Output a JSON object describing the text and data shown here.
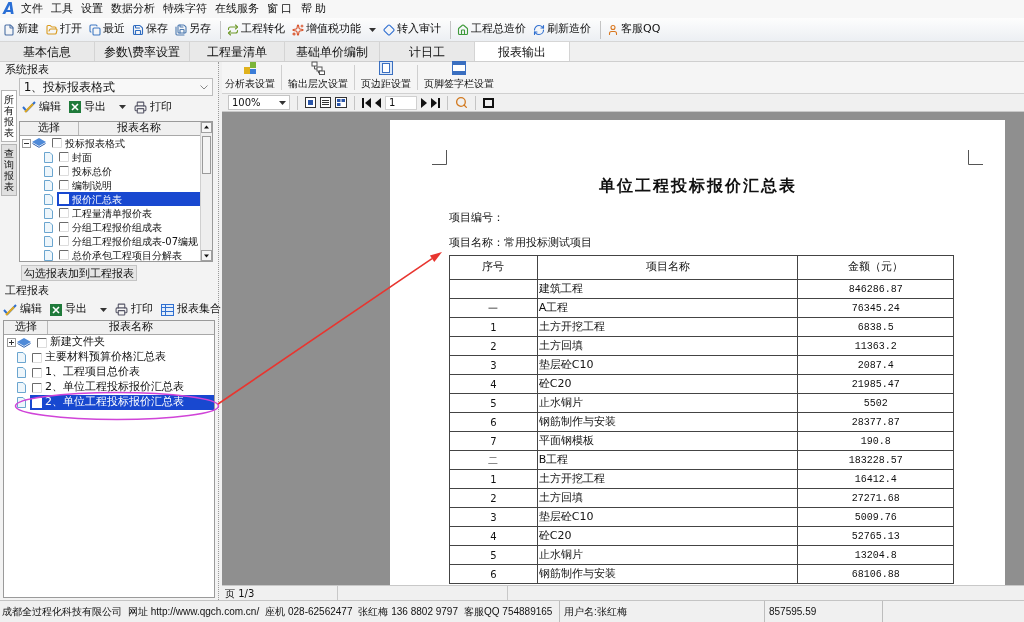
{
  "app_logo": "A",
  "menu": [
    "文件",
    "工具",
    "设置",
    "数据分析",
    "特殊字符",
    "在线服务",
    "窗 口",
    "帮 助"
  ],
  "toolbar": [
    {
      "items": [
        {
          "label": "新建",
          "has_menu": false
        },
        {
          "label": "打开",
          "has_menu": false
        },
        {
          "label": "最近",
          "has_menu": false
        },
        {
          "label": "保存",
          "has_menu": false
        },
        {
          "label": "另存",
          "has_menu": false
        }
      ]
    },
    {
      "items": [
        {
          "label": "工程转化",
          "has_menu": false
        },
        {
          "label": "增值税功能",
          "has_menu": true
        },
        {
          "label": "转入审计",
          "has_menu": false
        }
      ]
    },
    {
      "items": [
        {
          "label": "工程总造价",
          "has_menu": false
        },
        {
          "label": "刷新造价",
          "has_menu": false
        }
      ]
    },
    {
      "items": [
        {
          "label": "客服QQ",
          "has_menu": false
        }
      ]
    }
  ],
  "tabs": [
    {
      "label": "基本信息",
      "selected": false
    },
    {
      "label": "参数\\费率设置",
      "selected": false
    },
    {
      "label": "工程量清单",
      "selected": false
    },
    {
      "label": "基础单价编制",
      "selected": false
    },
    {
      "label": "计日工",
      "selected": false
    },
    {
      "label": "报表输出",
      "selected": true
    }
  ],
  "system_reports": {
    "title": "系统报表",
    "side_tabs": [
      {
        "label": "所有报表",
        "selected": true
      },
      {
        "label": "查询报表",
        "selected": false
      }
    ],
    "format_select": {
      "value": "1、投标报表格式"
    },
    "toolbar": [
      {
        "label": "编辑",
        "has_menu": false
      },
      {
        "label": "导出",
        "has_menu": true
      },
      {
        "label": "打印",
        "has_menu": false
      }
    ],
    "columns": [
      "选择",
      "报表名称"
    ],
    "tree": [
      {
        "kind": "folder",
        "label": "投标报表格式",
        "expanded": true,
        "checked": false,
        "selected": false,
        "children": [
          {
            "kind": "report",
            "label": "封面",
            "checked": false,
            "selected": false
          },
          {
            "kind": "report",
            "label": "投标总价",
            "checked": false,
            "selected": false
          },
          {
            "kind": "report",
            "label": "编制说明",
            "checked": false,
            "selected": false
          },
          {
            "kind": "report",
            "label": "报价汇总表",
            "checked": false,
            "selected": true
          },
          {
            "kind": "report",
            "label": "工程量清单报价表",
            "checked": false,
            "selected": false
          },
          {
            "kind": "report",
            "label": "分组工程报价组成表",
            "checked": false,
            "selected": false
          },
          {
            "kind": "report",
            "label": "分组工程报价组成表-07编规",
            "checked": false,
            "selected": false
          },
          {
            "kind": "report",
            "label": "总价承包工程项目分解表",
            "checked": false,
            "selected": false
          }
        ]
      }
    ],
    "add_button": "勾选报表加到工程报表"
  },
  "project_reports": {
    "title": "工程报表",
    "toolbar": [
      {
        "label": "编辑",
        "has_menu": false
      },
      {
        "label": "导出",
        "has_menu": true
      },
      {
        "label": "打印",
        "has_menu": false
      },
      {
        "label": "报表集合",
        "has_menu": false
      }
    ],
    "columns": [
      "选择",
      "报表名称"
    ],
    "tree": [
      {
        "kind": "folder",
        "label": "新建文件夹",
        "expanded": false,
        "checked": false,
        "selected": false
      },
      {
        "kind": "report",
        "label": "主要材料预算价格汇总表",
        "checked": false,
        "selected": false
      },
      {
        "kind": "report",
        "label": "1、工程项目总价表",
        "checked": false,
        "selected": false
      },
      {
        "kind": "report",
        "label": "2、单位工程投标报价汇总表",
        "checked": false,
        "selected": false
      },
      {
        "kind": "report",
        "label": "2、单位工程投标报价汇总表",
        "checked": false,
        "selected": true
      }
    ]
  },
  "report_toolbar": [
    {
      "label": "分析表设置"
    },
    {
      "label": "输出层次设置"
    },
    {
      "label": "页边距设置"
    },
    {
      "label": "页脚签字栏设置"
    }
  ],
  "preview_toolbar": {
    "zoom": "100%",
    "page": "1"
  },
  "report_page": {
    "title": "单位工程投标报价汇总表",
    "info": [
      "项目编号：",
      "项目名称：常用投标测试项目"
    ],
    "columns": [
      "序号",
      "项目名称",
      "金额（元）"
    ],
    "rows": [
      {
        "name": "建筑工程",
        "amount": "846286.87"
      },
      {
        "no": "一",
        "name": "A工程",
        "amount": "76345.24"
      },
      {
        "no": "1",
        "name": "土方开挖工程",
        "amount": "6838.5"
      },
      {
        "no": "2",
        "name": "土方回填",
        "amount": "11363.2"
      },
      {
        "no": "3",
        "name": "垫层砼C10",
        "amount": "2087.4"
      },
      {
        "no": "4",
        "name": "砼C20",
        "amount": "21985.47"
      },
      {
        "no": "5",
        "name": "止水铜片",
        "amount": "5502"
      },
      {
        "no": "6",
        "name": "钢筋制作与安装",
        "amount": "28377.87"
      },
      {
        "no": "7",
        "name": "平面钢模板",
        "amount": "190.8"
      },
      {
        "no": "二",
        "name": "B工程",
        "amount": "183228.57"
      },
      {
        "no": "1",
        "name": "土方开挖工程",
        "amount": "16412.4"
      },
      {
        "no": "2",
        "name": "土方回填",
        "amount": "27271.68"
      },
      {
        "no": "3",
        "name": "垫层砼C10",
        "amount": "5009.76"
      },
      {
        "no": "4",
        "name": "砼C20",
        "amount": "52765.13"
      },
      {
        "no": "5",
        "name": "止水铜片",
        "amount": "13204.8"
      },
      {
        "no": "6",
        "name": "钢筋制作与安装",
        "amount": "68106.88"
      }
    ]
  },
  "page_status": "页 1/3",
  "status_bar": {
    "company": [
      "成都全过程化科技有限公司",
      "网址 http://www.qgch.com.cn/",
      "座机 028-62562477",
      "张红梅 136 8802 9797",
      "客服QQ 754889165"
    ],
    "user": "用户名:张红梅",
    "total": "857595.59"
  }
}
